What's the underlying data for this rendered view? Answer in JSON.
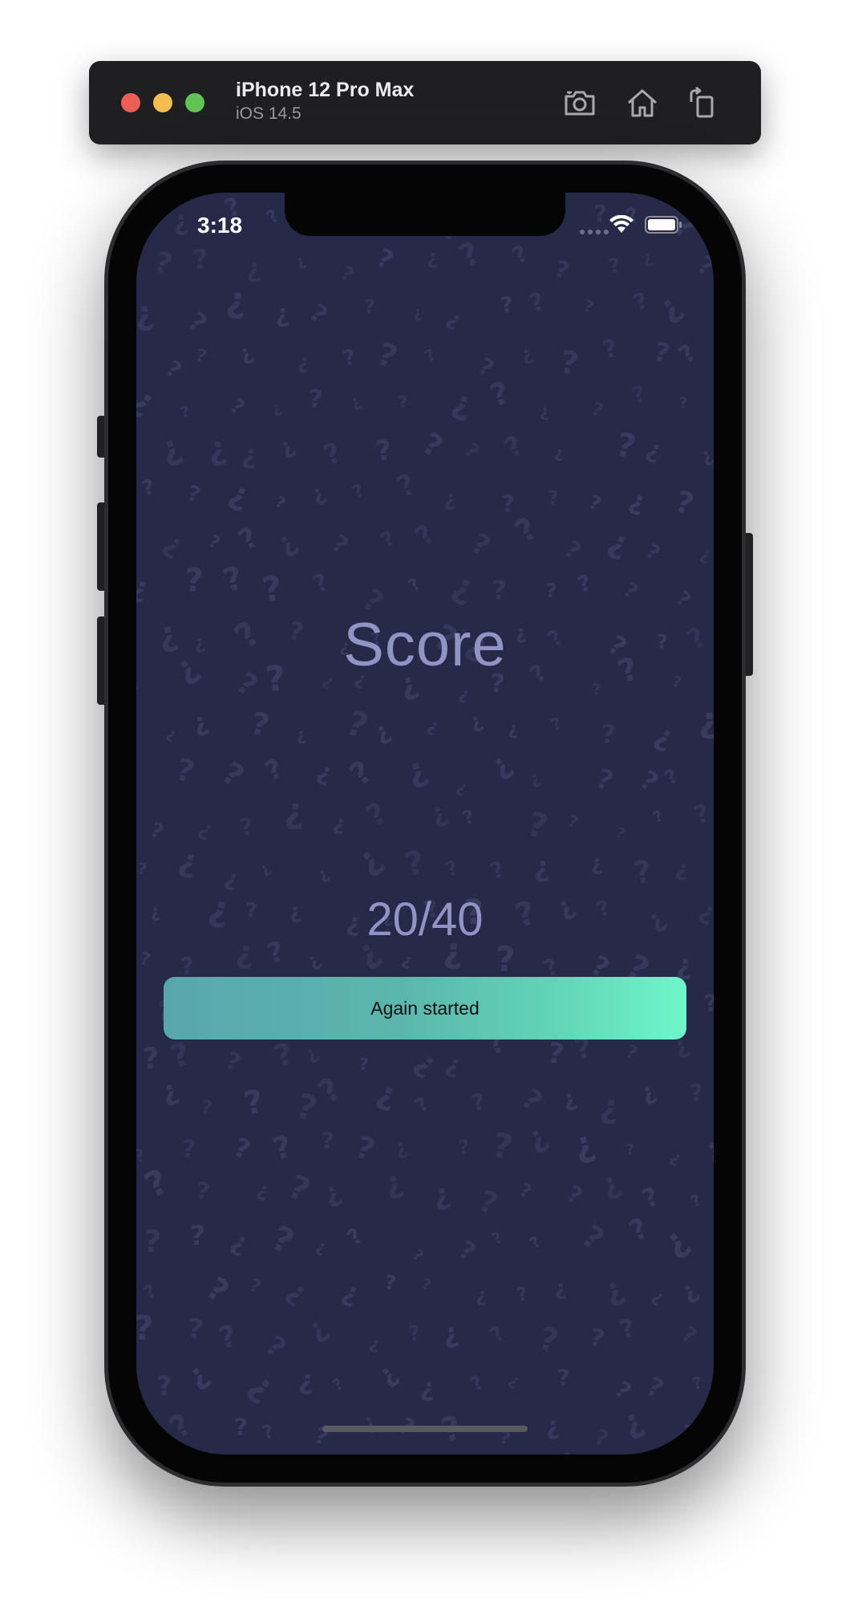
{
  "simulator": {
    "device_name": "iPhone 12 Pro Max",
    "os_version": "iOS 14.5",
    "buttons": {
      "screenshot_icon": "camera-icon",
      "home_icon": "home-icon",
      "rotate_icon": "rotate-icon"
    }
  },
  "status_bar": {
    "time": "3:18",
    "wifi_icon": "wifi-icon",
    "battery_icon": "battery-icon"
  },
  "app": {
    "title": "Score",
    "score": "20/40",
    "again_button_label": "Again started"
  },
  "colors": {
    "background": "#262947",
    "text": "#8f94c4",
    "button_gradient_start": "#5aa6ae",
    "button_gradient_end": "#6ff5ca"
  }
}
